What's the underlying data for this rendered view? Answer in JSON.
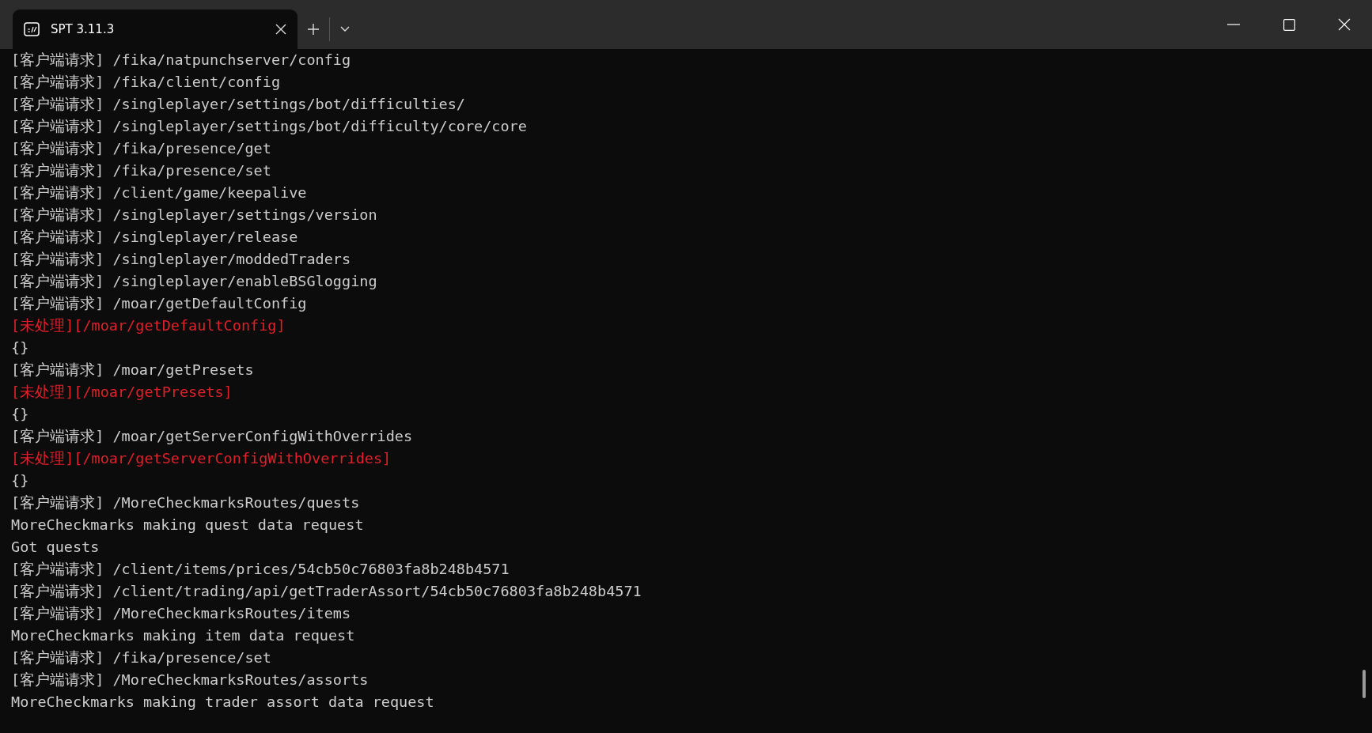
{
  "tab": {
    "title": "SPT 3.11.3",
    "selected": true
  },
  "lines": [
    {
      "text": "[客户端请求] /fika/natpunchserver/config",
      "kind": "normal"
    },
    {
      "text": "[客户端请求] /fika/client/config",
      "kind": "normal"
    },
    {
      "text": "[客户端请求] /singleplayer/settings/bot/difficulties/",
      "kind": "normal"
    },
    {
      "text": "[客户端请求] /singleplayer/settings/bot/difficulty/core/core",
      "kind": "normal"
    },
    {
      "text": "[客户端请求] /fika/presence/get",
      "kind": "normal"
    },
    {
      "text": "[客户端请求] /fika/presence/set",
      "kind": "normal"
    },
    {
      "text": "[客户端请求] /client/game/keepalive",
      "kind": "normal"
    },
    {
      "text": "[客户端请求] /singleplayer/settings/version",
      "kind": "normal"
    },
    {
      "text": "[客户端请求] /singleplayer/release",
      "kind": "normal"
    },
    {
      "text": "[客户端请求] /singleplayer/moddedTraders",
      "kind": "normal"
    },
    {
      "text": "[客户端请求] /singleplayer/enableBSGlogging",
      "kind": "normal"
    },
    {
      "text": "[客户端请求] /moar/getDefaultConfig",
      "kind": "normal"
    },
    {
      "text": "[未处理][/moar/getDefaultConfig]",
      "kind": "error"
    },
    {
      "text": "{}",
      "kind": "normal"
    },
    {
      "text": "[客户端请求] /moar/getPresets",
      "kind": "normal"
    },
    {
      "text": "[未处理][/moar/getPresets]",
      "kind": "error"
    },
    {
      "text": "{}",
      "kind": "normal"
    },
    {
      "text": "[客户端请求] /moar/getServerConfigWithOverrides",
      "kind": "normal"
    },
    {
      "text": "[未处理][/moar/getServerConfigWithOverrides]",
      "kind": "error"
    },
    {
      "text": "{}",
      "kind": "normal"
    },
    {
      "text": "[客户端请求] /MoreCheckmarksRoutes/quests",
      "kind": "normal"
    },
    {
      "text": "MoreCheckmarks making quest data request",
      "kind": "normal"
    },
    {
      "text": "Got quests",
      "kind": "normal"
    },
    {
      "text": "[客户端请求] /client/items/prices/54cb50c76803fa8b248b4571",
      "kind": "normal"
    },
    {
      "text": "[客户端请求] /client/trading/api/getTraderAssort/54cb50c76803fa8b248b4571",
      "kind": "normal"
    },
    {
      "text": "[客户端请求] /MoreCheckmarksRoutes/items",
      "kind": "normal"
    },
    {
      "text": "MoreCheckmarks making item data request",
      "kind": "normal"
    },
    {
      "text": "[客户端请求] /fika/presence/set",
      "kind": "normal"
    },
    {
      "text": "[客户端请求] /MoreCheckmarksRoutes/assorts",
      "kind": "normal"
    },
    {
      "text": "MoreCheckmarks making trader assort data request",
      "kind": "normal"
    }
  ]
}
